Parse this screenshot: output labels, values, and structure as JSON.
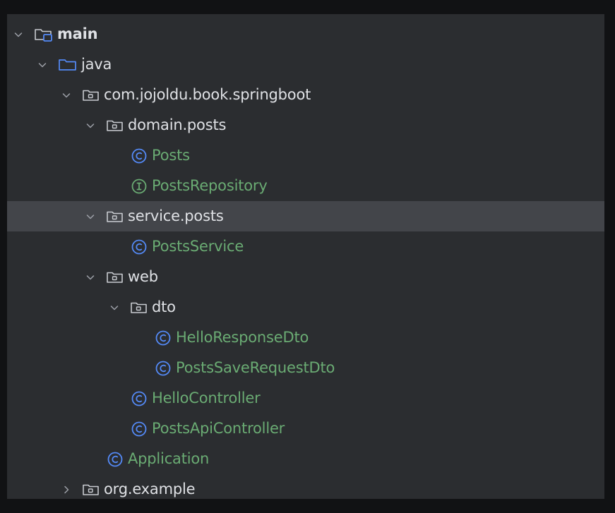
{
  "tree": [
    {
      "label": "main",
      "depth": 0,
      "chevron": "down",
      "icon": "source-root-folder-icon",
      "kind": "module",
      "bold": true
    },
    {
      "label": "java",
      "depth": 1,
      "chevron": "down",
      "icon": "java-source-folder-icon",
      "kind": "folder"
    },
    {
      "label": "com.jojoldu.book.springboot",
      "depth": 2,
      "chevron": "down",
      "icon": "package-icon",
      "kind": "package"
    },
    {
      "label": "domain.posts",
      "depth": 3,
      "chevron": "down",
      "icon": "package-icon",
      "kind": "package"
    },
    {
      "label": "Posts",
      "depth": 4,
      "chevron": "none",
      "icon": "class-icon",
      "kind": "class"
    },
    {
      "label": "PostsRepository",
      "depth": 4,
      "chevron": "none",
      "icon": "interface-icon",
      "kind": "interface"
    },
    {
      "label": "service.posts",
      "depth": 3,
      "chevron": "down",
      "icon": "package-icon",
      "kind": "package",
      "selected": true
    },
    {
      "label": "PostsService",
      "depth": 4,
      "chevron": "none",
      "icon": "class-icon",
      "kind": "class"
    },
    {
      "label": "web",
      "depth": 3,
      "chevron": "down",
      "icon": "package-icon",
      "kind": "package"
    },
    {
      "label": "dto",
      "depth": 4,
      "chevron": "down",
      "icon": "package-icon",
      "kind": "package"
    },
    {
      "label": "HelloResponseDto",
      "depth": 5,
      "chevron": "none",
      "icon": "class-icon",
      "kind": "class"
    },
    {
      "label": "PostsSaveRequestDto",
      "depth": 5,
      "chevron": "none",
      "icon": "class-icon",
      "kind": "class"
    },
    {
      "label": "HelloController",
      "depth": 4,
      "chevron": "none",
      "icon": "class-icon",
      "kind": "class"
    },
    {
      "label": "PostsApiController",
      "depth": 4,
      "chevron": "none",
      "icon": "class-icon",
      "kind": "class"
    },
    {
      "label": "Application",
      "depth": 3,
      "chevron": "none",
      "icon": "class-icon",
      "kind": "class"
    },
    {
      "label": "org.example",
      "depth": 2,
      "chevron": "right",
      "icon": "package-icon",
      "kind": "package"
    }
  ],
  "colors": {
    "panel_bg": "#2b2d30",
    "selected_bg": "#43454a",
    "package_text": "#dfe1e5",
    "class_text": "#6aab73",
    "class_icon": "#548af7",
    "interface_icon": "#6aab73",
    "folder_icon": "#548af7",
    "chevron": "#9da0a8"
  }
}
